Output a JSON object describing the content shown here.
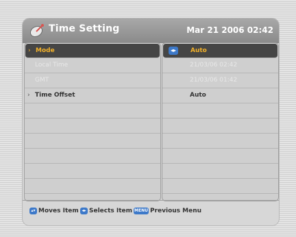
{
  "header": {
    "title": "Time Setting",
    "datetime": "Mar 21 2006 02:42",
    "icon": "satellite-dish-icon"
  },
  "rows": [
    {
      "label": "Mode",
      "value": "Auto",
      "state": "selected"
    },
    {
      "label": "Local Time",
      "value": "21/03/06 02:42",
      "state": "disabled"
    },
    {
      "label": "GMT",
      "value": "21/03/06 01:42",
      "state": "disabled"
    },
    {
      "label": "Time Offset",
      "value": "Auto",
      "state": "normal"
    }
  ],
  "footer": {
    "moves": "Moves Item",
    "selects": "Selects Item",
    "menu_key": "MENU",
    "previous": "Previous Menu"
  },
  "colors": {
    "accent": "#f2b12a",
    "selected_bg": "#454545",
    "key_blue": "#3d79c9"
  }
}
